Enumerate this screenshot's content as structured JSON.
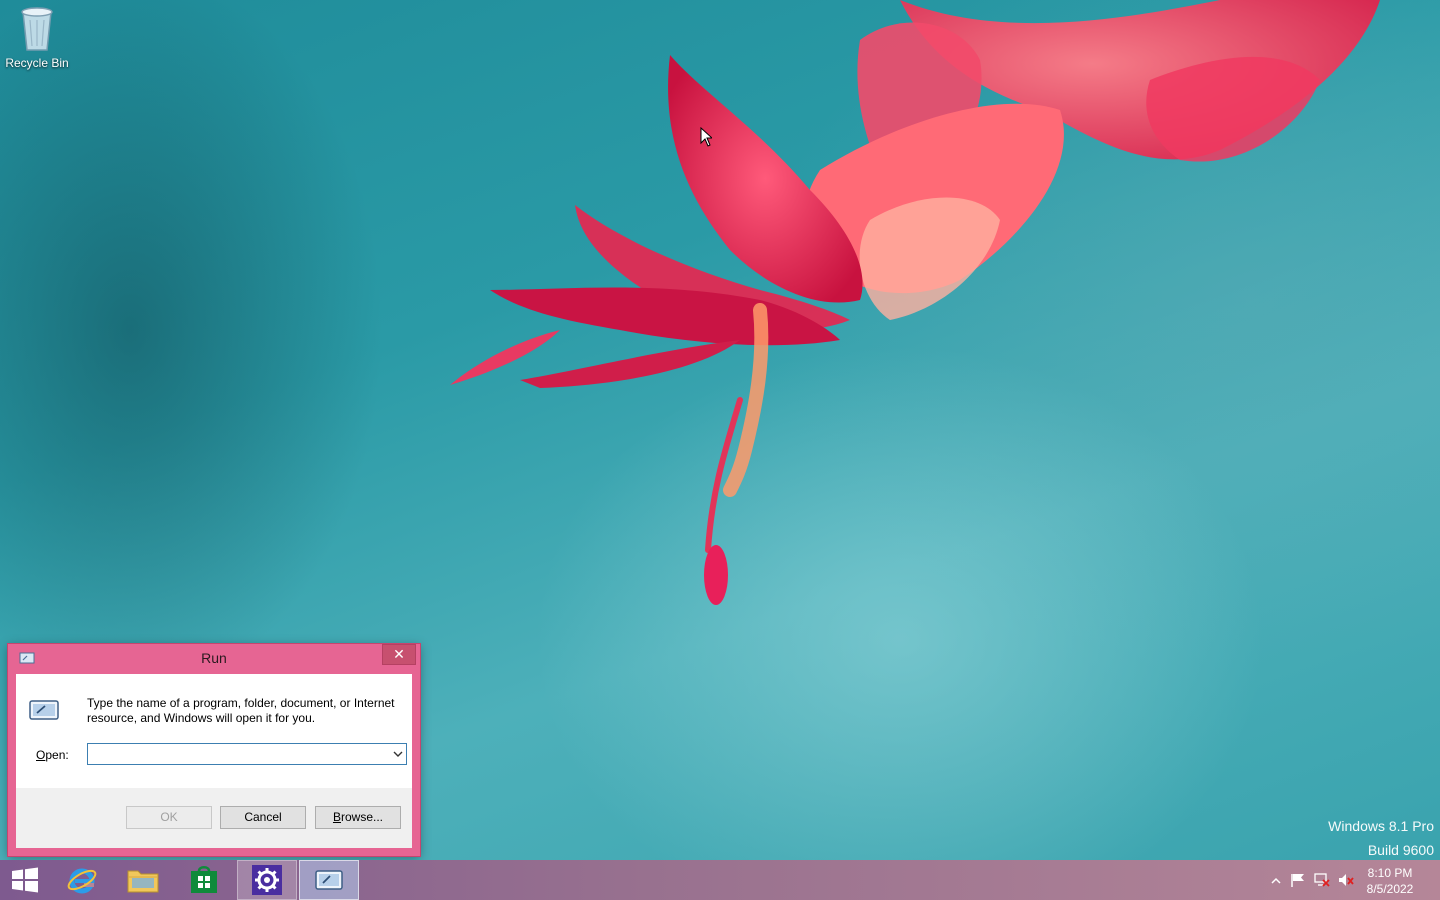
{
  "desktop": {
    "icons": [
      {
        "label": "Recycle Bin",
        "icon": "recycle-bin-icon"
      }
    ],
    "watermark": {
      "line1": "Windows 8.1 Pro",
      "line2": "Build 9600"
    }
  },
  "run_dialog": {
    "title": "Run",
    "close_glyph": "✕",
    "description": "Type the name of a program, folder, document, or Internet resource, and Windows will open it for you.",
    "open_label_mnemonic": "O",
    "open_label_rest": "pen:",
    "open_value": "",
    "buttons": {
      "ok": "OK",
      "cancel": "Cancel",
      "browse_mnemonic": "B",
      "browse_rest": "rowse..."
    }
  },
  "taskbar": {
    "items": [
      {
        "name": "start-button",
        "icon": "windows-logo-icon"
      },
      {
        "name": "internet-explorer",
        "icon": "internet-explorer-icon"
      },
      {
        "name": "file-explorer",
        "icon": "folder-icon"
      },
      {
        "name": "windows-store",
        "icon": "store-icon"
      },
      {
        "name": "settings",
        "icon": "gear-icon"
      },
      {
        "name": "run",
        "icon": "run-icon"
      }
    ],
    "tray": {
      "icons": [
        "chevron-up-icon",
        "flag-icon",
        "network-icon",
        "speaker-muted-icon"
      ],
      "time": "8:10 PM",
      "date": "8/5/2022"
    }
  },
  "colors": {
    "window_frame": "#e66593",
    "taskbar_start": "#7e5a8f",
    "taskbar_end": "#b58698",
    "desktop_teal": "#2a9aa6"
  }
}
